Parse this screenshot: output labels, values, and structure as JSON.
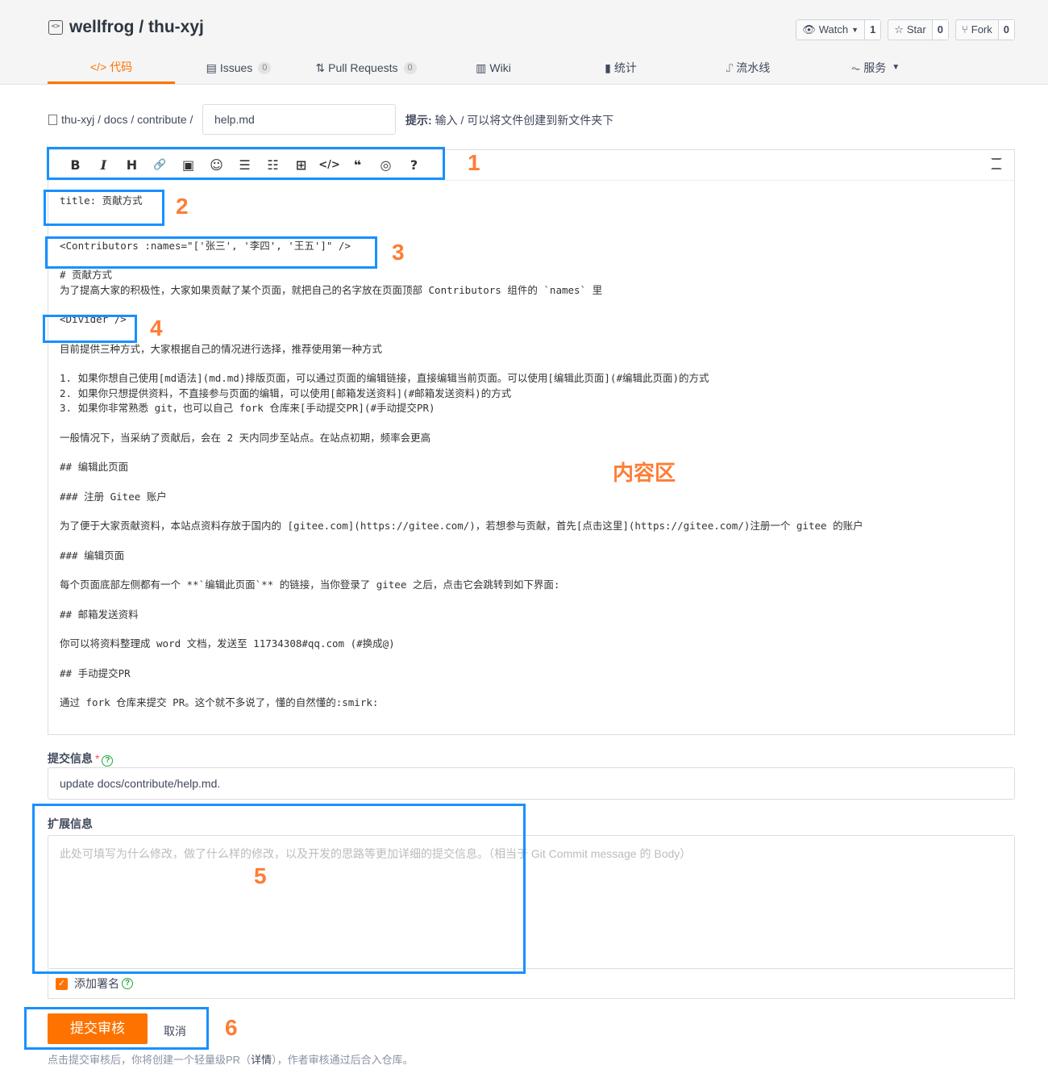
{
  "header": {
    "repo_owner": "wellfrog",
    "separator": " / ",
    "repo_name": "thu-xyj",
    "watch": {
      "label": "Watch",
      "count": "1"
    },
    "star": {
      "label": "Star",
      "count": "0"
    },
    "fork": {
      "label": "Fork",
      "count": "0"
    }
  },
  "tabs": [
    {
      "label": "代码",
      "icon": "code-icon"
    },
    {
      "label": "Issues",
      "icon": "issues-icon",
      "badge": "0"
    },
    {
      "label": "Pull Requests",
      "icon": "pull-request-icon",
      "badge": "0"
    },
    {
      "label": "Wiki",
      "icon": "wiki-icon"
    },
    {
      "label": "统计",
      "icon": "stats-icon"
    },
    {
      "label": "流水线",
      "icon": "pipeline-icon"
    },
    {
      "label": "服务",
      "icon": "service-icon"
    }
  ],
  "path": {
    "crumbs": "thu-xyj / docs / contribute /",
    "filename": "help.md",
    "hint_label": "提示:",
    "hint_text": " 输入 / 可以将文件创建到新文件夹下"
  },
  "toolbar": [
    "B",
    "I",
    "H",
    "🔗",
    "▣",
    "☺",
    "☰",
    "☷",
    "⊞",
    "</>",
    "❝",
    "◎",
    "?"
  ],
  "editor": {
    "line_title": "title: 贡献方式",
    "line_contrib": "<Contributors :names=\"['张三', '李四', '王五']\" />",
    "line_h1": "# 贡献方式",
    "line_intro": "为了提高大家的积极性，大家如果贡献了某个页面，就把自己的名字放在页面顶部 Contributors 组件的 `names` 里",
    "line_divider": "<Divider />",
    "line_three": "目前提供三种方式，大家根据自己的情况进行选择，推荐使用第一种方式",
    "line_l1": "1. 如果你想自己使用[md语法](md.md)排版页面，可以通过页面的编辑链接，直接编辑当前页面。可以使用[编辑此页面](#编辑此页面)的方式",
    "line_l2": "2. 如果你只想提供资料，不直接参与页面的编辑，可以使用[邮箱发送资料](#邮箱发送资料)的方式",
    "line_l3": "3. 如果你非常熟悉 git，也可以自己 fork 仓库来[手动提交PR](#手动提交PR)",
    "line_general": "一般情况下，当采纳了贡献后，会在 2 天内同步至站点。在站点初期，频率会更高",
    "line_h2a": "## 编辑此页面",
    "line_h3a": "### 注册 Gitee 账户",
    "line_gitee": "为了便于大家贡献资料，本站点资料存放于国内的 [gitee.com](https://gitee.com/)，若想参与贡献，首先[点击这里](https://gitee.com/)注册一个 gitee 的账户",
    "line_h3b": "### 编辑页面",
    "line_each": "每个页面底部左侧都有一个 **`编辑此页面`** 的链接，当你登录了 gitee 之后，点击它会跳转到如下界面:",
    "line_h2b": "## 邮箱发送资料",
    "line_mail": "你可以将资料整理成 word 文档，发送至 11734308#qq.com (#换成@)",
    "line_h2c": "## 手动提交PR",
    "line_pr": "通过 fork 仓库来提交 PR。这个就不多说了，懂的自然懂的:smirk:",
    "content_label": "内容区"
  },
  "annotations": [
    "1",
    "2",
    "3",
    "4",
    "5",
    "6"
  ],
  "commit": {
    "label": "提交信息",
    "required": "*",
    "value": "update docs/contribute/help.md."
  },
  "extend": {
    "label": "扩展信息",
    "placeholder": "此处可填写为什么修改，做了什么样的修改，以及开发的思路等更加详细的提交信息。（相当于 Git Commit message 的 Body）"
  },
  "sign": {
    "label": "添加署名",
    "check": "✓"
  },
  "actions": {
    "submit": "提交审核",
    "cancel": "取消",
    "note_pre": "点击提交审核后，你将创建一个轻量级PR（",
    "note_link": "详情",
    "note_post": "），作者审核通过后合入仓库。"
  },
  "colors": {
    "accent": "#fe7300",
    "annotation_box": "#1890ff",
    "annotation_num": "#fe7d35"
  }
}
